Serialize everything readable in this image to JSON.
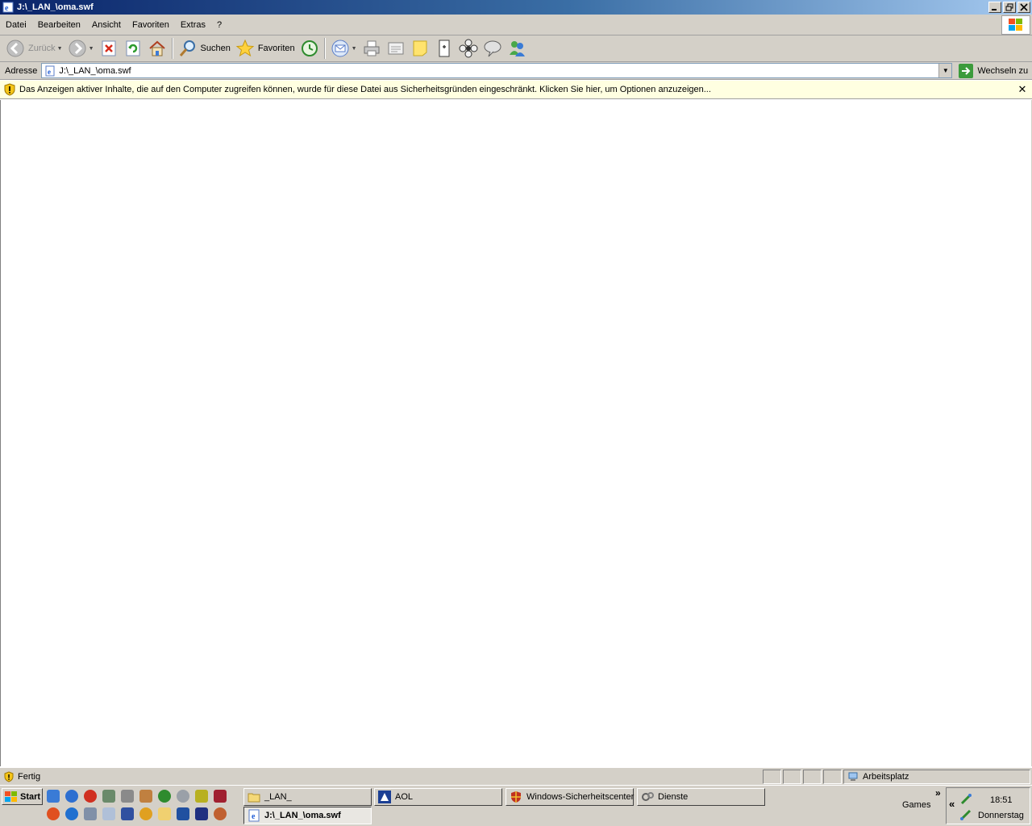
{
  "window": {
    "title": "J:\\_LAN_\\oma.swf"
  },
  "menu": {
    "items": [
      "Datei",
      "Bearbeiten",
      "Ansicht",
      "Favoriten",
      "Extras",
      "?"
    ]
  },
  "toolbar": {
    "back_label": "Zurück",
    "search_label": "Suchen",
    "favorites_label": "Favoriten"
  },
  "address": {
    "label": "Adresse",
    "value": "J:\\_LAN_\\oma.swf",
    "go_label": "Wechseln zu"
  },
  "infobar": {
    "message": "Das Anzeigen aktiver Inhalte, die auf den Computer zugreifen können, wurde für diese Datei aus Sicherheitsgründen eingeschränkt. Klicken Sie hier, um Optionen anzuzeigen..."
  },
  "status": {
    "text": "Fertig",
    "zone": "Arbeitsplatz"
  },
  "taskbar": {
    "start_label": "Start",
    "tasks": [
      "_LAN_",
      "AOL",
      "Windows-Sicherheitscenter",
      "Dienste",
      "J:\\_LAN_\\oma.swf"
    ],
    "games_label": "Games",
    "clock_time": "18:51",
    "clock_day": "Donnerstag"
  },
  "colors": {
    "titlebar_start": "#0a246a",
    "titlebar_end": "#a6caf0",
    "chrome": "#d4d0c8",
    "infobar": "#ffffe1"
  }
}
